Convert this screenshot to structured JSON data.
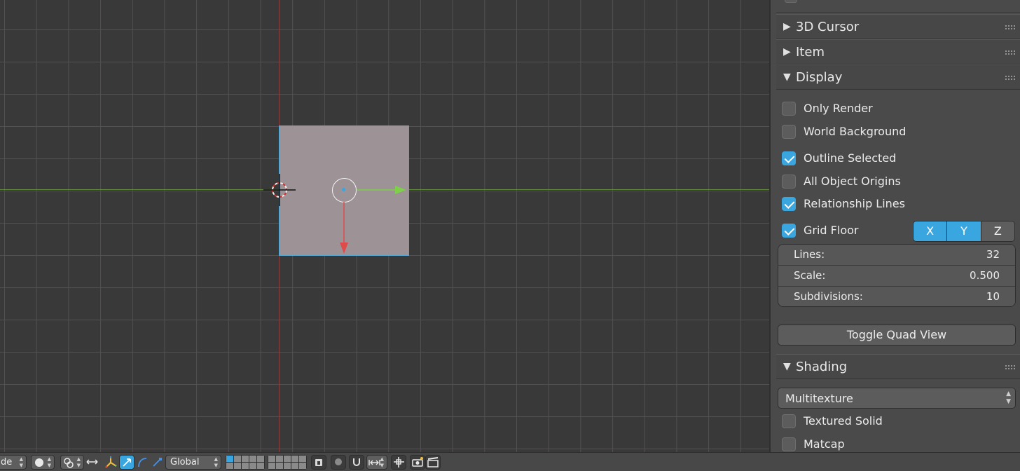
{
  "viewport": {
    "axis_colors": {
      "x": "#5e8a3a",
      "y": "#8a4040"
    },
    "object_color": "#9d9396",
    "selection_outline": "#4fa8d8"
  },
  "panel": {
    "sections": [
      {
        "label": "3D Cursor",
        "expanded": false
      },
      {
        "label": "Item",
        "expanded": false
      },
      {
        "label": "Display",
        "expanded": true
      },
      {
        "label": "Shading",
        "expanded": true
      }
    ],
    "display": {
      "checkboxes": [
        {
          "label": "Only Render",
          "checked": false
        },
        {
          "label": "World Background",
          "checked": false
        },
        {
          "label": "Outline Selected",
          "checked": true
        },
        {
          "label": "All Object Origins",
          "checked": false
        },
        {
          "label": "Relationship Lines",
          "checked": true
        },
        {
          "label": "Grid Floor",
          "checked": true
        }
      ],
      "axis_toggles": [
        {
          "label": "X",
          "active": true
        },
        {
          "label": "Y",
          "active": true
        },
        {
          "label": "Z",
          "active": false
        }
      ],
      "fields": [
        {
          "label": "Lines:",
          "value": "32"
        },
        {
          "label": "Scale:",
          "value": "0.500"
        },
        {
          "label": "Subdivisions:",
          "value": "10"
        }
      ],
      "toggle_quad_view": "Toggle Quad View"
    },
    "shading": {
      "mode": "Multitexture",
      "checkboxes": [
        {
          "label": "Textured Solid",
          "checked": false
        },
        {
          "label": "Matcap",
          "checked": false
        }
      ]
    }
  },
  "toolbar": {
    "mode_fragment": "de",
    "orientation": "Global",
    "accent": "#3aa6e0"
  }
}
